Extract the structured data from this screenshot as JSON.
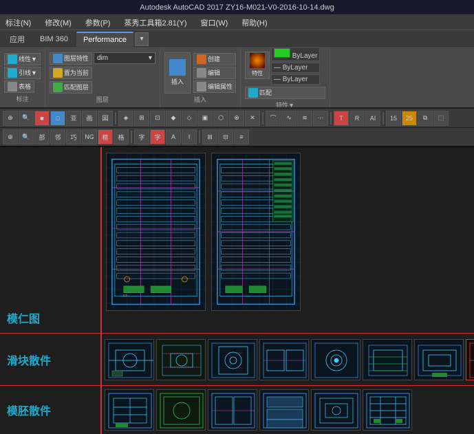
{
  "titleBar": {
    "text": "Autodesk AutoCAD 2017    ZY16-M021-V0-2016-10-14.dwg"
  },
  "menuBar": {
    "items": [
      "标注(N)",
      "修改(M)",
      "参数(P)",
      "蒸秀工具箱2.81(Y)",
      "窗口(W)",
      "帮助(H)"
    ]
  },
  "tabs": [
    {
      "label": "应用",
      "active": false
    },
    {
      "label": "BIM 360",
      "active": false
    },
    {
      "label": "Performance",
      "active": true
    }
  ],
  "ribbon": {
    "sections": [
      {
        "name": "标注",
        "buttons": [
          "线性▼",
          "引线▼",
          "表格"
        ]
      },
      {
        "name": "图层",
        "buttons": [
          "图层特性",
          "置为当前",
          "匹配图层"
        ]
      },
      {
        "name": "插入",
        "buttons": [
          "创建",
          "编辑",
          "编辑属性"
        ]
      },
      {
        "name": "特性",
        "layerLabel": "ByLayer",
        "colorLabel": "ByLayer",
        "linetypeLabel": "ByLayer",
        "matchLabel": "特性匹配"
      }
    ],
    "layerDropdown": "dim"
  },
  "toolbar": {
    "buttons": [
      "⟲",
      "⟳",
      "□",
      "▷",
      "◁",
      "▽",
      "△",
      "◈",
      "⊕",
      "⊙",
      "⊗",
      "∅",
      "◻",
      "▪",
      "▫",
      "⬛",
      "◆",
      "✕",
      "⋯",
      "⌚",
      "⊞",
      "⊟",
      "⊠",
      "⊡",
      "◱",
      "◰",
      "◳",
      "◲",
      "▦",
      "▧",
      "▨",
      "▩"
    ]
  },
  "sections": [
    {
      "id": "morentu",
      "label": "模仁图",
      "thumbnails": []
    },
    {
      "id": "huaxisanjian",
      "label": "滑块散件",
      "thumbnails": [
        "t1",
        "t2",
        "t3",
        "t4",
        "t5",
        "t6",
        "t7",
        "t8",
        "t9",
        "t10"
      ]
    },
    {
      "id": "mofensanjian",
      "label": "模胚散件",
      "thumbnails": [
        "t1",
        "t2",
        "t3",
        "t4",
        "t5",
        "t6"
      ]
    }
  ],
  "colors": {
    "accent": "#22aacc",
    "redLine": "#cc3333",
    "bg": "#1e1e1e",
    "ribbon": "#4a4a4a"
  }
}
